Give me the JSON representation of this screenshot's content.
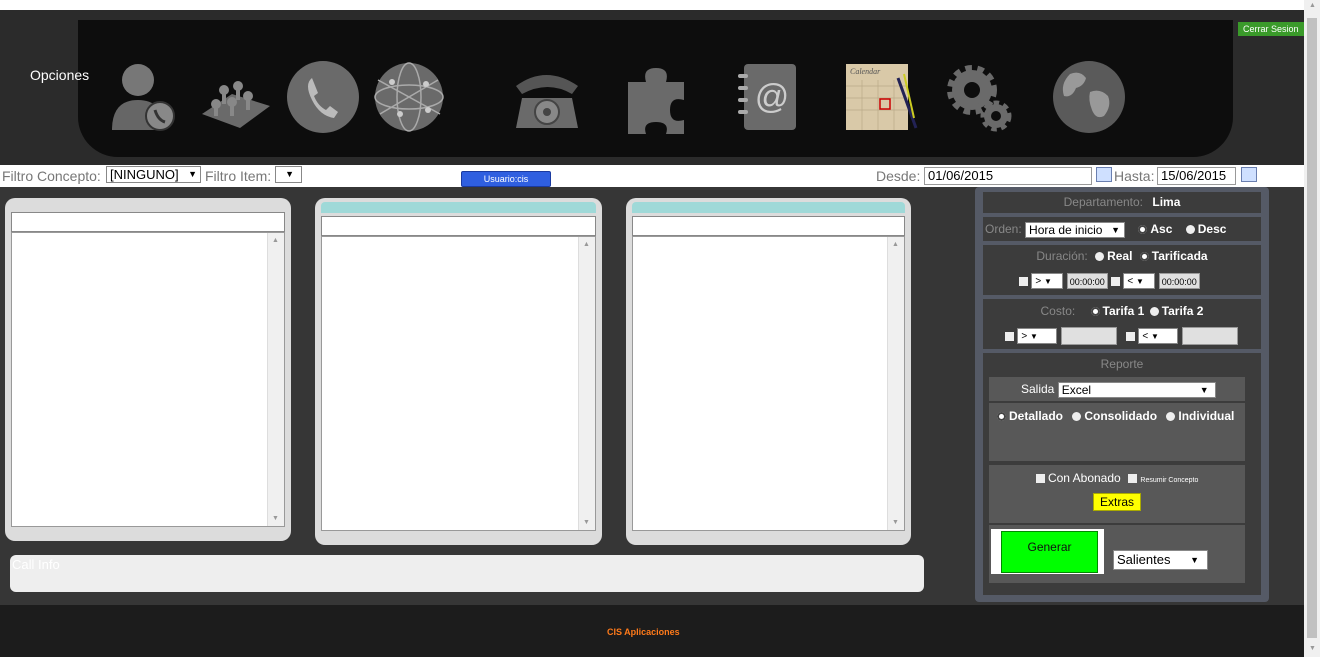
{
  "header": {
    "options_label": "Opciones",
    "logout_label": "Cerrar Sesion",
    "icons": [
      "user-phone-icon",
      "map-pins-icon",
      "phone-circle-icon",
      "globe-network-icon",
      "rotary-phone-icon",
      "puzzle-icon",
      "address-book-icon",
      "calendar-icon",
      "gears-icon",
      "world-globe-icon"
    ],
    "calendar_icon_label": "Calendar"
  },
  "filters": {
    "concept_label": "Filtro Concepto:",
    "concept_value": "[NINGUNO]",
    "item_label": "Filtro Item:",
    "item_value": "",
    "user_label": "Usuario:cis",
    "from_label": "Desde:",
    "from_value": "01/06/2015",
    "to_label": "Hasta:",
    "to_value": "15/06/2015"
  },
  "call_info_label": "Call Info",
  "right_panel": {
    "department_label": "Departamento:",
    "department_value": "Lima",
    "order_label": "Orden:",
    "order_value": "Hora de inicio",
    "asc_label": "Asc",
    "desc_label": "Desc",
    "duration_label": "Duración:",
    "real_label": "Real",
    "tarificada_label": "Tarificada",
    "gt_op": ">",
    "lt_op": "<",
    "dur_min": "00:00:00",
    "dur_max": "00:00:00",
    "cost_label": "Costo:",
    "tarifa1_label": "Tarifa 1",
    "tarifa2_label": "Tarifa 2",
    "report_label": "Reporte",
    "output_label": "Salida",
    "output_value": "Excel",
    "detallado_label": "Detallado",
    "consolidado_label": "Consolidado",
    "individual_label": "Individual",
    "con_abonado_label": "Con Abonado",
    "resumir_label": "Resumir Concepto",
    "extras_label": "Extras",
    "generar_label": "Generar",
    "direction_value": "Salientes"
  },
  "footer_text": "CIS Aplicaciones"
}
